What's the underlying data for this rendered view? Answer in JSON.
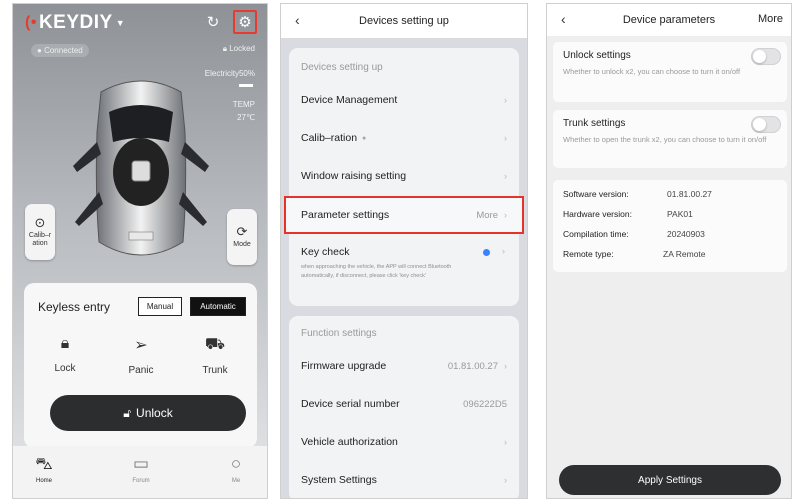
{
  "screen1": {
    "brand": "KEYDIY",
    "status_connected": "Connected",
    "status_locked": "Locked",
    "electricity": "Electricity50%",
    "electricity_level": 0.5,
    "temp_label": "TEMP",
    "temp_value": "27℃",
    "calib_label": "Calib–r ation",
    "mode_label": "Mode",
    "keyless": {
      "title": "Keyless entry",
      "manual": "Manual",
      "automatic": "Automatic",
      "lock": "Lock",
      "panic": "Panic",
      "trunk": "Trunk",
      "unlock": "Unlock"
    },
    "tabs": {
      "home": "Home",
      "forum": "Forum",
      "me": "Me"
    },
    "icons": {
      "refresh": "refresh-icon",
      "settings": "gear-icon"
    }
  },
  "screen2": {
    "title": "Devices setting up",
    "devices_section": "Devices setting up",
    "rows": {
      "device_management": "Device Management",
      "calibration": "Calib–ration",
      "window_raising": "Window raising setting",
      "parameter_settings": "Parameter settings",
      "parameter_more": "More",
      "key_check": "Key check",
      "key_check_desc": "when approaching the vehicle, the APP will connect Bluetooth automatically, if disconnect, please click 'key check'"
    },
    "function_section": "Function settings",
    "function_rows": {
      "firmware_upgrade": "Firmware upgrade",
      "firmware_version": "01.81.00.27",
      "device_serial": "Device serial number",
      "serial_value": "096222D5",
      "vehicle_auth": "Vehicle authorization",
      "system_settings": "System Settings"
    }
  },
  "screen3": {
    "title": "Device parameters",
    "more": "More",
    "unlock_settings": {
      "title": "Unlock settings",
      "desc": "Whether to unlock x2, you can choose to turn it on/off",
      "enabled": false
    },
    "trunk_settings": {
      "title": "Trunk settings",
      "desc": "Whether to open the trunk x2, you can choose to turn it on/off",
      "enabled": false
    },
    "info": {
      "software_label": "Software version:",
      "software_value": "01.81.00.27",
      "hardware_label": "Hardware version:",
      "hardware_value": "PAK01",
      "compilation_label": "Compilation time:",
      "compilation_value": "20240903",
      "remote_label": "Remote type:",
      "remote_value": "ZA Remote"
    },
    "apply": "Apply Settings"
  },
  "colors": {
    "highlight": "#e5322b",
    "accent_blue": "#3a82ff",
    "dark_button": "#2c2d2f"
  }
}
